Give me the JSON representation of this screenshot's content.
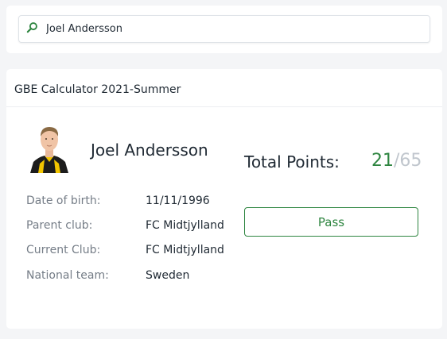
{
  "search": {
    "value": "Joel Andersson"
  },
  "calculator": {
    "title": "GBE Calculator 2021-Summer"
  },
  "player": {
    "name": "Joel Andersson",
    "info": [
      {
        "label": "Date of birth:",
        "value": "11/11/1996"
      },
      {
        "label": "Parent club:",
        "value": "FC Midtjylland"
      },
      {
        "label": "Current Club:",
        "value": "FC Midtjylland"
      },
      {
        "label": "National team:",
        "value": "Sweden"
      }
    ]
  },
  "points": {
    "label": "Total Points:",
    "current": "21",
    "separator": "/",
    "max": "65"
  },
  "result": {
    "label": "Pass"
  },
  "colors": {
    "accent": "#2e8540",
    "muted": "#c0c6cd",
    "background": "#f4f5f7"
  },
  "icons": {
    "search": "search-icon",
    "avatar": "player-avatar"
  }
}
